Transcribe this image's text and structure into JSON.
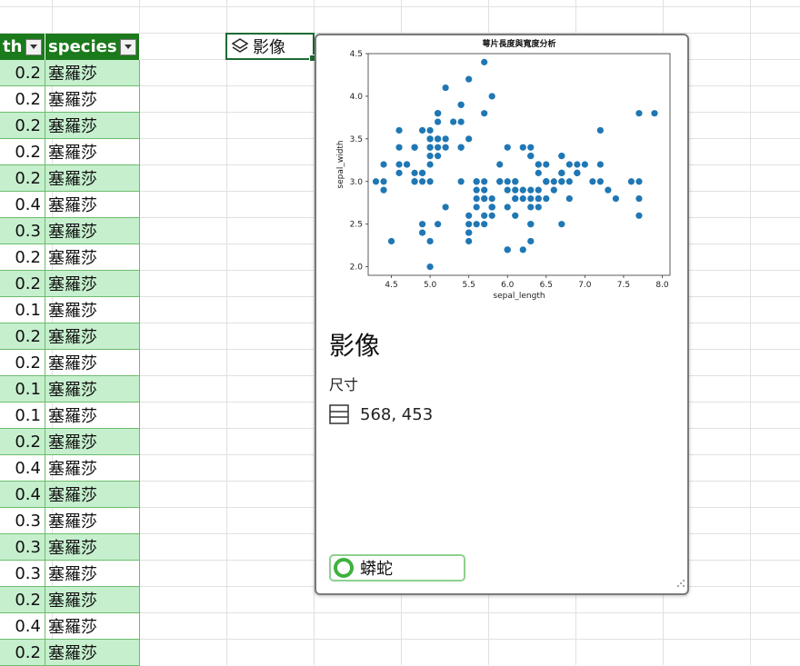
{
  "table": {
    "headers": [
      "th",
      "species"
    ],
    "rows": [
      [
        "0.2",
        "塞羅莎"
      ],
      [
        "0.2",
        "塞羅莎"
      ],
      [
        "0.2",
        "塞羅莎"
      ],
      [
        "0.2",
        "塞羅莎"
      ],
      [
        "0.2",
        "塞羅莎"
      ],
      [
        "0.4",
        "塞羅莎"
      ],
      [
        "0.3",
        "塞羅莎"
      ],
      [
        "0.2",
        "塞羅莎"
      ],
      [
        "0.2",
        "塞羅莎"
      ],
      [
        "0.1",
        "塞羅莎"
      ],
      [
        "0.2",
        "塞羅莎"
      ],
      [
        "0.2",
        "塞羅莎"
      ],
      [
        "0.1",
        "塞羅莎"
      ],
      [
        "0.1",
        "塞羅莎"
      ],
      [
        "0.2",
        "塞羅莎"
      ],
      [
        "0.4",
        "塞羅莎"
      ],
      [
        "0.4",
        "塞羅莎"
      ],
      [
        "0.3",
        "塞羅莎"
      ],
      [
        "0.3",
        "塞羅莎"
      ],
      [
        "0.3",
        "塞羅莎"
      ],
      [
        "0.2",
        "塞羅莎"
      ],
      [
        "0.4",
        "塞羅莎"
      ],
      [
        "0.2",
        "塞羅莎"
      ]
    ]
  },
  "active_cell": {
    "icon": "layers-icon",
    "label": "影像"
  },
  "card": {
    "title": "影像",
    "dimensions_label": "尺寸",
    "dimensions_value": "568, 453",
    "source_label": "蟒蛇"
  },
  "colors": {
    "header_green": "#1b7a1b",
    "row_alt": "#c6efce",
    "dot": "#1f77b4"
  },
  "chart_data": {
    "type": "scatter",
    "title": "萼片長度與寬度分析",
    "xlabel": "sepal_length",
    "ylabel": "sepal_width",
    "xlim": [
      4.2,
      8.1
    ],
    "ylim": [
      1.9,
      4.5
    ],
    "xticks": [
      "4.5",
      "5.0",
      "5.5",
      "6.0",
      "6.5",
      "7.0",
      "7.5",
      "8.0"
    ],
    "yticks": [
      "2.0",
      "2.5",
      "3.0",
      "3.5",
      "4.0",
      "4.5"
    ],
    "points": [
      [
        5.1,
        3.5
      ],
      [
        4.9,
        3.0
      ],
      [
        4.7,
        3.2
      ],
      [
        4.6,
        3.1
      ],
      [
        5.0,
        3.6
      ],
      [
        5.4,
        3.9
      ],
      [
        4.6,
        3.4
      ],
      [
        5.0,
        3.4
      ],
      [
        4.4,
        2.9
      ],
      [
        4.9,
        3.1
      ],
      [
        5.4,
        3.7
      ],
      [
        4.8,
        3.4
      ],
      [
        4.8,
        3.0
      ],
      [
        4.3,
        3.0
      ],
      [
        5.8,
        4.0
      ],
      [
        5.7,
        4.4
      ],
      [
        5.4,
        3.9
      ],
      [
        5.1,
        3.5
      ],
      [
        5.7,
        3.8
      ],
      [
        5.1,
        3.8
      ],
      [
        5.4,
        3.4
      ],
      [
        5.1,
        3.7
      ],
      [
        4.6,
        3.6
      ],
      [
        5.1,
        3.3
      ],
      [
        4.8,
        3.4
      ],
      [
        5.0,
        3.0
      ],
      [
        5.0,
        3.4
      ],
      [
        5.2,
        3.5
      ],
      [
        5.2,
        3.4
      ],
      [
        4.7,
        3.2
      ],
      [
        4.8,
        3.1
      ],
      [
        5.4,
        3.4
      ],
      [
        5.2,
        4.1
      ],
      [
        5.5,
        4.2
      ],
      [
        4.9,
        3.1
      ],
      [
        5.0,
        3.2
      ],
      [
        5.5,
        3.5
      ],
      [
        4.9,
        3.6
      ],
      [
        4.4,
        3.0
      ],
      [
        5.1,
        3.4
      ],
      [
        5.0,
        3.5
      ],
      [
        4.5,
        2.3
      ],
      [
        4.4,
        3.2
      ],
      [
        5.0,
        3.5
      ],
      [
        5.1,
        3.8
      ],
      [
        4.8,
        3.0
      ],
      [
        5.1,
        3.8
      ],
      [
        4.6,
        3.2
      ],
      [
        5.3,
        3.7
      ],
      [
        5.0,
        3.3
      ],
      [
        7.0,
        3.2
      ],
      [
        6.4,
        3.2
      ],
      [
        6.9,
        3.1
      ],
      [
        5.5,
        2.3
      ],
      [
        6.5,
        2.8
      ],
      [
        5.7,
        2.8
      ],
      [
        6.3,
        3.3
      ],
      [
        4.9,
        2.4
      ],
      [
        6.6,
        2.9
      ],
      [
        5.2,
        2.7
      ],
      [
        5.0,
        2.0
      ],
      [
        5.9,
        3.0
      ],
      [
        6.0,
        2.2
      ],
      [
        6.1,
        2.9
      ],
      [
        5.6,
        2.9
      ],
      [
        6.7,
        3.1
      ],
      [
        5.6,
        3.0
      ],
      [
        5.8,
        2.7
      ],
      [
        6.2,
        2.2
      ],
      [
        5.6,
        2.5
      ],
      [
        5.9,
        3.2
      ],
      [
        6.1,
        2.8
      ],
      [
        6.3,
        2.5
      ],
      [
        6.1,
        2.8
      ],
      [
        6.4,
        2.9
      ],
      [
        6.6,
        3.0
      ],
      [
        6.8,
        2.8
      ],
      [
        6.7,
        3.0
      ],
      [
        6.0,
        2.9
      ],
      [
        5.7,
        2.6
      ],
      [
        5.5,
        2.4
      ],
      [
        5.5,
        2.4
      ],
      [
        5.8,
        2.7
      ],
      [
        6.0,
        2.7
      ],
      [
        5.4,
        3.0
      ],
      [
        6.0,
        3.4
      ],
      [
        6.7,
        3.1
      ],
      [
        6.3,
        2.3
      ],
      [
        5.6,
        3.0
      ],
      [
        5.5,
        2.5
      ],
      [
        5.5,
        2.6
      ],
      [
        6.1,
        3.0
      ],
      [
        5.8,
        2.6
      ],
      [
        5.0,
        2.3
      ],
      [
        5.6,
        2.7
      ],
      [
        5.7,
        3.0
      ],
      [
        5.7,
        2.9
      ],
      [
        6.2,
        2.9
      ],
      [
        5.1,
        2.5
      ],
      [
        5.7,
        2.8
      ],
      [
        6.3,
        3.3
      ],
      [
        5.8,
        2.7
      ],
      [
        7.1,
        3.0
      ],
      [
        6.3,
        2.9
      ],
      [
        6.5,
        3.0
      ],
      [
        7.6,
        3.0
      ],
      [
        4.9,
        2.5
      ],
      [
        7.3,
        2.9
      ],
      [
        6.7,
        2.5
      ],
      [
        7.2,
        3.6
      ],
      [
        6.5,
        3.2
      ],
      [
        6.4,
        2.7
      ],
      [
        6.8,
        3.0
      ],
      [
        5.7,
        2.5
      ],
      [
        5.8,
        2.8
      ],
      [
        6.4,
        3.2
      ],
      [
        6.5,
        3.0
      ],
      [
        7.7,
        3.8
      ],
      [
        7.7,
        2.6
      ],
      [
        6.0,
        2.2
      ],
      [
        6.9,
        3.2
      ],
      [
        5.6,
        2.8
      ],
      [
        7.7,
        2.8
      ],
      [
        6.3,
        2.7
      ],
      [
        6.7,
        3.3
      ],
      [
        7.2,
        3.2
      ],
      [
        6.2,
        2.8
      ],
      [
        6.1,
        3.0
      ],
      [
        6.4,
        2.8
      ],
      [
        7.2,
        3.0
      ],
      [
        7.4,
        2.8
      ],
      [
        7.9,
        3.8
      ],
      [
        6.4,
        2.8
      ],
      [
        6.3,
        2.8
      ],
      [
        6.1,
        2.6
      ],
      [
        7.7,
        3.0
      ],
      [
        6.3,
        3.4
      ],
      [
        6.4,
        3.1
      ],
      [
        6.0,
        3.0
      ],
      [
        6.9,
        3.1
      ],
      [
        6.7,
        3.1
      ],
      [
        6.9,
        3.1
      ],
      [
        5.8,
        2.7
      ],
      [
        6.8,
        3.2
      ],
      [
        6.7,
        3.3
      ],
      [
        6.7,
        3.0
      ],
      [
        6.3,
        2.5
      ],
      [
        6.5,
        3.0
      ],
      [
        6.2,
        3.4
      ],
      [
        5.9,
        3.0
      ]
    ]
  }
}
